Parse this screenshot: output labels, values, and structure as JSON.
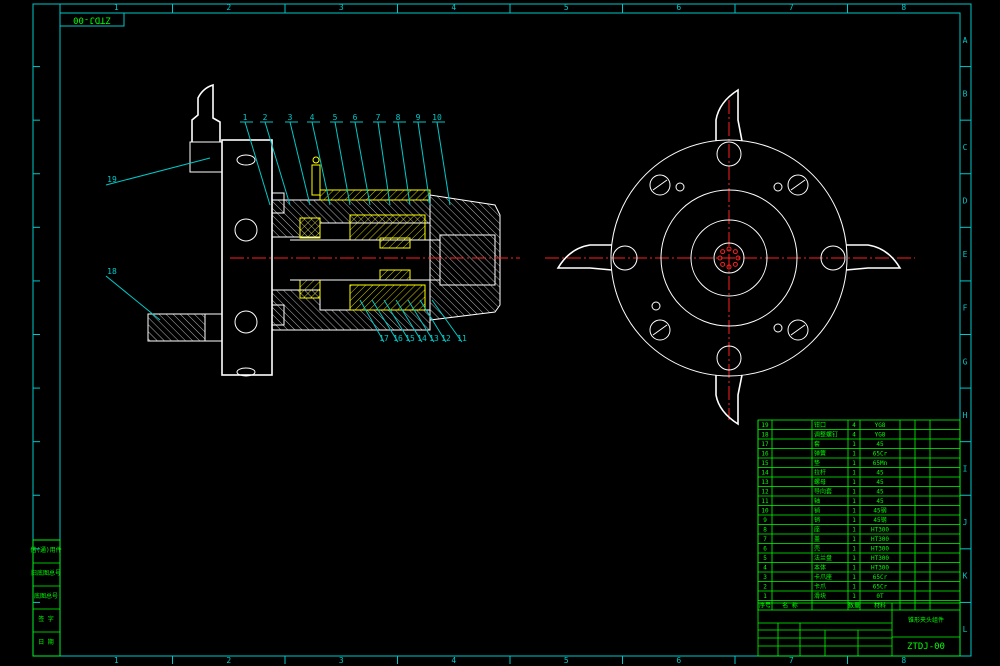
{
  "drawing": {
    "code_top": "ZTDJ-00",
    "code_bottom": "ZTDJ-00",
    "title": "锥形夹头组件"
  },
  "border": {
    "columns": [
      "1",
      "2",
      "3",
      "4",
      "5",
      "6",
      "7",
      "8"
    ],
    "rows": [
      "A",
      "B",
      "C",
      "D",
      "E",
      "F",
      "G",
      "H",
      "I",
      "J",
      "K",
      "L"
    ]
  },
  "leaders": {
    "top": [
      "1",
      "2",
      "3",
      "4",
      "5",
      "6",
      "7",
      "8",
      "9",
      "10"
    ],
    "bottom": [
      "17",
      "16",
      "15",
      "14",
      "13",
      "12",
      "11"
    ],
    "left": [
      "19",
      "18"
    ]
  },
  "bom": [
    {
      "no": "19",
      "name": "钳口",
      "qty": "4",
      "mat": "YG8"
    },
    {
      "no": "18",
      "name": "调整螺钉",
      "qty": "4",
      "mat": "YG8"
    },
    {
      "no": "17",
      "name": "套",
      "qty": "1",
      "mat": "45"
    },
    {
      "no": "16",
      "name": "弹簧",
      "qty": "1",
      "mat": "65Cr"
    },
    {
      "no": "15",
      "name": "垫",
      "qty": "1",
      "mat": "65Mn"
    },
    {
      "no": "14",
      "name": "拉杆",
      "qty": "1",
      "mat": "45"
    },
    {
      "no": "13",
      "name": "螺母",
      "qty": "1",
      "mat": "45"
    },
    {
      "no": "12",
      "name": "导向套",
      "qty": "1",
      "mat": "45"
    },
    {
      "no": "11",
      "name": "轴",
      "qty": "1",
      "mat": "45"
    },
    {
      "no": "10",
      "name": "销",
      "qty": "1",
      "mat": "45钢"
    },
    {
      "no": "9",
      "name": "销",
      "qty": "1",
      "mat": "45钢"
    },
    {
      "no": "8",
      "name": "座",
      "qty": "1",
      "mat": "HT300"
    },
    {
      "no": "7",
      "name": "盖",
      "qty": "1",
      "mat": "HT300"
    },
    {
      "no": "6",
      "name": "壳",
      "qty": "1",
      "mat": "HT300"
    },
    {
      "no": "5",
      "name": "法兰盘",
      "qty": "1",
      "mat": "HT300"
    },
    {
      "no": "4",
      "name": "本体",
      "qty": "1",
      "mat": "HT300"
    },
    {
      "no": "3",
      "name": "卡爪座",
      "qty": "1",
      "mat": "65Cr"
    },
    {
      "no": "2",
      "name": "卡爪",
      "qty": "1",
      "mat": "65Cr"
    },
    {
      "no": "1",
      "name": "滑块",
      "qty": "1",
      "mat": "0T"
    }
  ],
  "bom_header": [
    "序号",
    "名 称",
    "数量",
    "材料"
  ],
  "side_labels": [
    "借(通)用件",
    "旧底图总号",
    "底图总号",
    "签 字",
    "日 期"
  ],
  "colors": {
    "frame": "#00c8c8",
    "drawing": "#ffffff",
    "hatch": "#ffff00",
    "center": "#ff2020",
    "table": "#00ff00"
  }
}
